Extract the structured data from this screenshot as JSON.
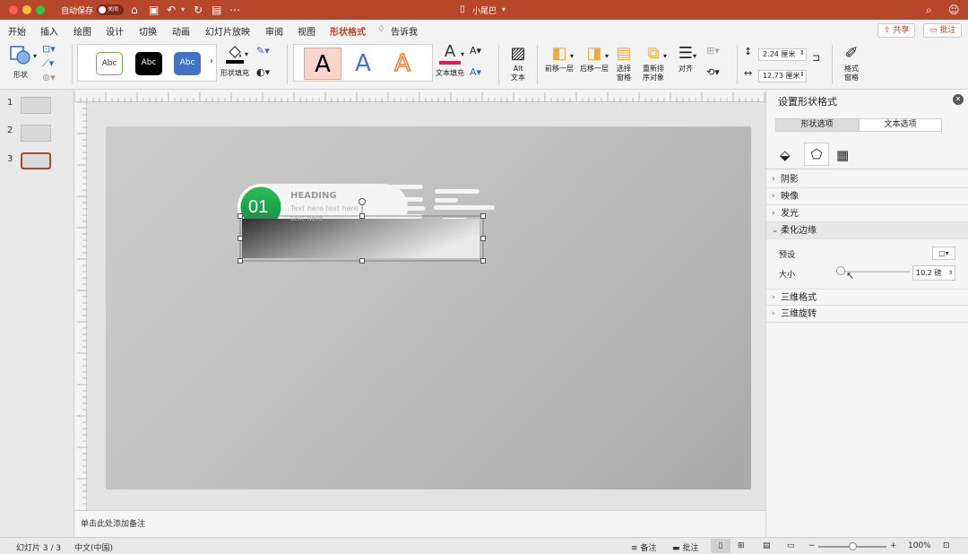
{
  "titlebar": {
    "autosave_label": "自动保存",
    "autosave_state": "关闭",
    "doc_title": "小尾巴"
  },
  "menu": {
    "items": [
      "开始",
      "插入",
      "绘图",
      "设计",
      "切换",
      "动画",
      "幻灯片放映",
      "审阅",
      "视图",
      "形状格式"
    ],
    "tell_me": "告诉我",
    "share": "共享",
    "comments": "批注"
  },
  "ribbon": {
    "shape_label": "形状",
    "style_samples": [
      "Abc",
      "Abc",
      "Abc"
    ],
    "fill_label": "形状填充",
    "wordart_sample": "A",
    "text_fill_label": "文本填充",
    "alt_text_label": "Alt\n文本",
    "bring_forward": "前移一层",
    "send_backward": "后移一层",
    "selection_pane": "选择\n窗格",
    "reorder": "重新排\n序对象",
    "align": "对齐",
    "height_value": "2.24 厘米",
    "width_value": "12.73 厘米",
    "format_pane": "格式\n窗格",
    "colors": {
      "accent": "#b7472a",
      "style2": "#000000",
      "style3": "#4472c4"
    }
  },
  "slides_panel": {
    "numbers": [
      "1",
      "2",
      "3"
    ],
    "selected": 3
  },
  "slide": {
    "badge_number": "01",
    "heading": "HEADING",
    "body_line1": "Text here text here",
    "body_line2": "text here"
  },
  "notes": {
    "placeholder": "单击此处添加备注"
  },
  "pane": {
    "title": "设置形状格式",
    "tab_shape": "形状选项",
    "tab_text": "文本选项",
    "sections": [
      "阴影",
      "映像",
      "发光",
      "柔化边缘"
    ],
    "preset_label": "预设",
    "size_label": "大小",
    "size_value": "10.2 磅",
    "size_slider_fraction": 0.06,
    "sections_after": [
      "三维格式",
      "三维旋转"
    ]
  },
  "status": {
    "slide_info": "幻灯片 3 / 3",
    "language": "中文(中国)",
    "notes_btn": "备注",
    "comments_btn": "批注",
    "zoom": "100%",
    "zoom_fraction": 0.5
  }
}
